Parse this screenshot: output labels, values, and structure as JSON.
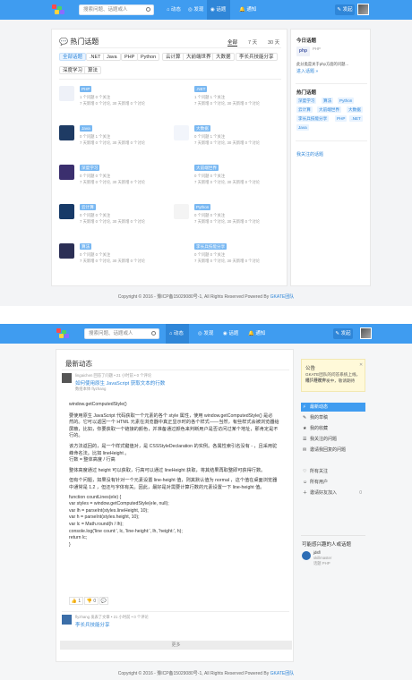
{
  "shot1": {
    "nav": {
      "search_placeholder": "搜索问题、话题或人",
      "items": [
        "动态",
        "发现",
        "话题",
        "通知"
      ],
      "ask": "发起"
    },
    "title": "热门话题",
    "ranges": [
      "全部",
      "7 天",
      "30 天"
    ],
    "chips": [
      "全部话题",
      ".NET",
      "Java",
      "PHP",
      "Python",
      "云计算",
      "大前端世界",
      "大数据",
      "李长兵技能分享",
      "深度学习",
      "算法"
    ],
    "cards": [
      {
        "tag": "PHP",
        "q": "1 个问题 0 个关注",
        "stats": "7 天新增 0 个讨论, 30 天新增 0 个讨论",
        "color": "#eef1f8",
        "icon": "php-logo"
      },
      {
        "tag": ".NET",
        "q": "1 个问题 1 个关注",
        "stats": "7 天新增 0 个讨论, 30 天新增 0 个讨论",
        "color": "#fff",
        "icon": "dotnet-logo"
      },
      {
        "tag": "Java",
        "q": "0 个问题 1 个关注",
        "stats": "7 天新增 0 个讨论, 30 天新增 0 个讨论",
        "color": "#1e3b64",
        "icon": "java-logo"
      },
      {
        "tag": "大数据",
        "q": "0 个问题 1 个关注",
        "stats": "7 天新增 0 个讨论, 30 天新增 0 个讨论",
        "color": "#f2f5fb",
        "icon": "bigdata-logo"
      },
      {
        "tag": "深度学习",
        "q": "0 个问题 0 个关注",
        "stats": "7 天新增 0 个讨论, 30 天新增 0 个讨论",
        "color": "#3b2f6e",
        "icon": "deep-learning-image"
      },
      {
        "tag": "大前端世界",
        "q": "0 个问题 0 个关注",
        "stats": "7 天新增 0 个讨论, 30 天新增 0 个讨论",
        "color": "#fff",
        "icon": "frontend-logo"
      },
      {
        "tag": "云计算",
        "q": "0 个问题 0 个关注",
        "stats": "7 天新增 0 个讨论, 30 天新增 0 个讨论",
        "color": "#173a68",
        "icon": "cloud-image"
      },
      {
        "tag": "Python",
        "q": "0 个问题 0 个关注",
        "stats": "7 天新增 0 个讨论, 30 天新增 0 个讨论",
        "color": "#f4f4f4",
        "icon": "python-logo"
      },
      {
        "tag": "算法",
        "q": "0 个问题 0 个关注",
        "stats": "7 天新增 0 个讨论, 30 天新增 0 个讨论",
        "color": "#2b2f55",
        "icon": "algorithm-image"
      },
      {
        "tag": "李长兵技能分享",
        "q": "0 个问题 0 个关注",
        "stats": "7 天新增 0 个讨论, 30 天新增 0 个讨论",
        "color": "#fff",
        "icon": "skills-logo"
      }
    ],
    "side": {
      "today": "今日话题",
      "today_tag": "PHP",
      "today_q": "此分类是关于php方面的问题...",
      "enter": "进入话题 »",
      "hot": "热门话题",
      "hot_tags": [
        "深度学习",
        "算法",
        "Python",
        "云计算",
        "大前端世界",
        "大数据",
        "李长兵技能分享",
        "PHP",
        ".NET",
        "Java"
      ],
      "follow": "我关注的话题"
    },
    "footer": "Copyright © 2016 - 豫ICP备15029080号-1, All Rights Reserved Powered By",
    "footer_brand": "GKATE团队"
  },
  "shot2": {
    "nav": {
      "search_placeholder": "搜索问题、话题或人",
      "items": [
        "动态",
        "发现",
        "话题",
        "通知"
      ],
      "ask": "发起"
    },
    "feed_title": "最新动态",
    "post1": {
      "meta": "lingaichen 回答了问题 • 21 小时前 • 0 个评论",
      "question": "如何使用原生 JavaScript 获取文本的行数",
      "tags": "数组本体 flyzhang",
      "lines": [
        "window.getComputedStyle()",
        "",
        "要使用原生 JavaScript 代码获取一个元素的各个 style 属性，使用 window.getComputedStyle() 是必",
        "然的。它可以返回一个 HTML 元素在浏览器中真正显示时的各个样式——当然，有些样式会被浏览器给",
        "屏蔽，比如，你要获取一个链接的颜色，并准备通过颜色来判断用户是否访问过某个地址，那肯定是不",
        "行的。",
        "",
        "该方法返回的，是一个样式键值对，是 CSSStyleDeclaration 的实例。各属性索引名没有 - ，且采用驼",
        "峰命名法。比如 lineHeight 。",
        "行数 = 整体高度 / 行高",
        "",
        "整体高度通过 height 可以获取，行高可以通过 lineHeight 获取，将其结果再取整即可获得行数。",
        "",
        "但有个问题，如果没有针对一个元素设置 line-height 值，则其默认值为 normal ，这个值在桌面浏览器",
        "中通常是 1.2 ，但还与字体有关。因此，最好是对需要计算行数的元素设置一下 line-height 值。",
        "",
        "function countLines(ele) {",
        "var styles = window.getComputedStyle(ele, null);",
        "var lh = parseInt(styles.lineHeight, 10);",
        "var h = parseInt(styles.height, 10);",
        "var lc = Math.round(h / lh);",
        "console.log('line count:', lc, 'line-height:', lh, 'height:', h);",
        "return lc;",
        "}"
      ],
      "vote": "1",
      "zero": "0"
    },
    "post2": {
      "meta": "flyzhang 发表了文章 • 21 小时前 • 0 个评论",
      "title": "李长兵技能分享"
    },
    "more": "更多",
    "note_title": "公告",
    "note_text": "GKATE团队的问答系统上线，继续开发中...",
    "note_text2": "线，继续开发中，敬请期待",
    "menu": [
      "最新动态",
      "我的草稿",
      "我的收藏",
      "我关注的问题",
      "邀请我回复的问题",
      "所有关注",
      "所有用户",
      "邀请好友加入"
    ],
    "menu_counts": [
      "",
      "",
      "",
      "",
      "",
      "",
      "",
      "0"
    ],
    "maybe": "可能感兴趣的人或话题",
    "person": {
      "name": "jdsfl",
      "line": "skillmaster",
      "extra": "话题 PHP"
    },
    "footer": "Copyright © 2016 - 豫ICP备15029080号-1, All Rights Reserved Powered By",
    "footer_brand": "GKATE团队"
  }
}
